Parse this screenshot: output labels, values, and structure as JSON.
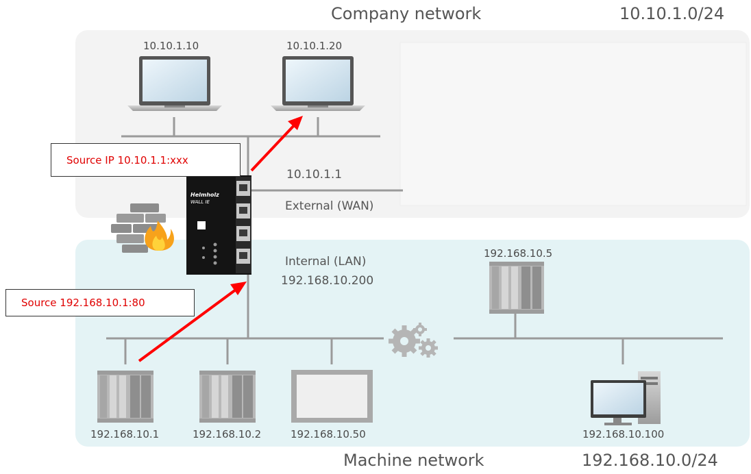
{
  "zones": {
    "company": {
      "title": "Company network",
      "subnet": "10.10.1.0/24"
    },
    "machine": {
      "title": "Machine network",
      "subnet": "192.168.10.0/24"
    }
  },
  "company_hosts": [
    {
      "ip": "10.10.1.10"
    },
    {
      "ip": "10.10.1.20"
    }
  ],
  "device": {
    "brand": "Helmholz",
    "model": "WALL IE",
    "wan_ip": "10.10.1.1",
    "wan_label": "External (WAN)",
    "lan_label": "Internal (LAN)",
    "lan_ip": "192.168.10.200"
  },
  "callouts": {
    "wan_source": "Source IP 10.10.1.1:xxx",
    "lan_source": "Source 192.168.10.1:80"
  },
  "machine_hosts": [
    {
      "ip": "192.168.10.1"
    },
    {
      "ip": "192.168.10.2"
    },
    {
      "ip": "192.168.10.50"
    },
    {
      "ip": "192.168.10.5"
    },
    {
      "ip": "192.168.10.100"
    }
  ],
  "colors": {
    "company_zone": "#f3f3f3",
    "machine_zone": "#e4f3f5",
    "arrow": "#ff0000",
    "wire": "#9a9a9a"
  }
}
